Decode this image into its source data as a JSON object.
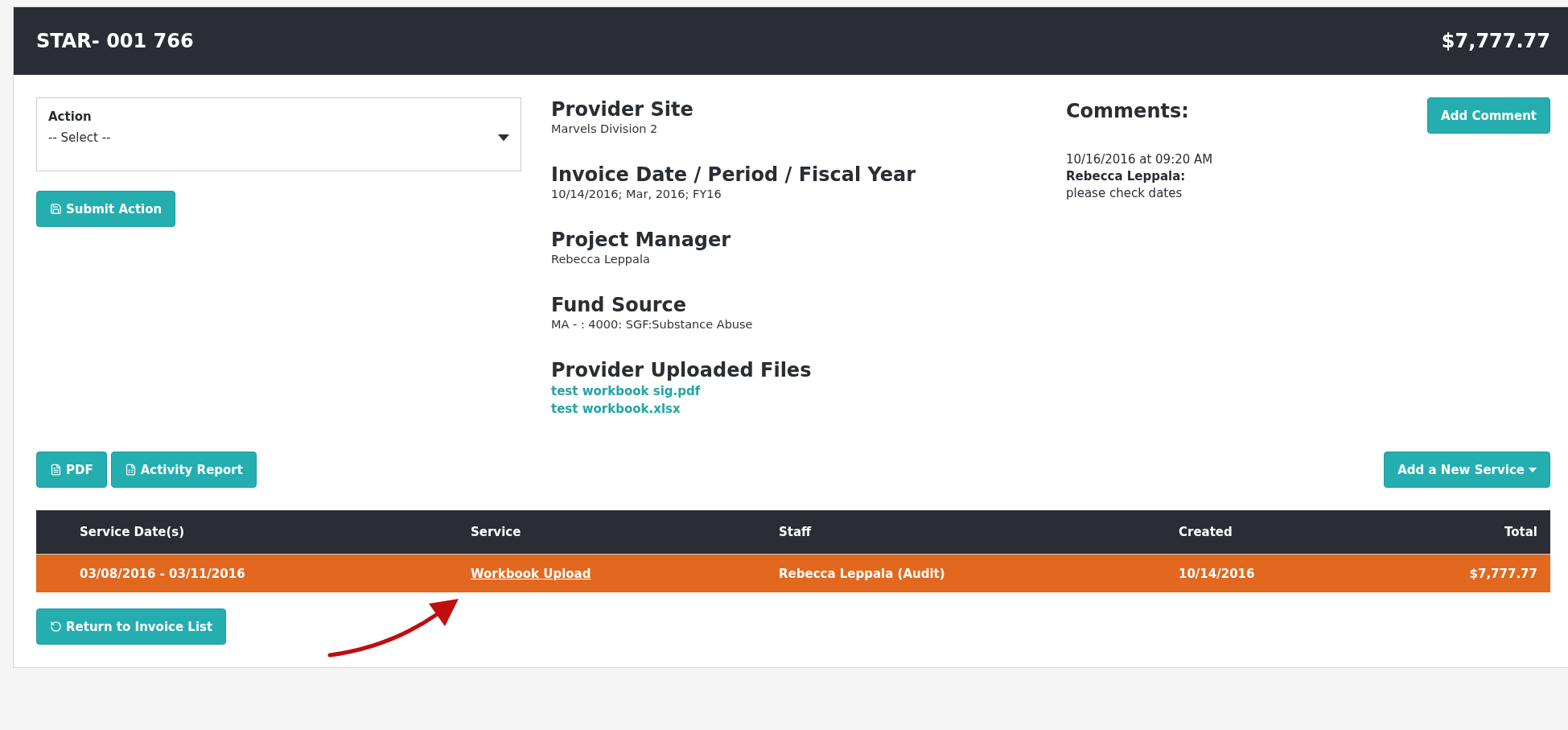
{
  "header": {
    "title": "STAR- 001 766",
    "amount": "$7,777.77"
  },
  "action_field": {
    "label": "Action",
    "value": "-- Select --"
  },
  "submit_button": {
    "label": "Submit Action"
  },
  "details": [
    {
      "heading": "Provider Site",
      "value": "Marvels Division 2"
    },
    {
      "heading": "Invoice Date / Period / Fiscal Year",
      "value": "10/14/2016; Mar, 2016; FY16"
    },
    {
      "heading": "Project Manager",
      "value": "Rebecca Leppala"
    },
    {
      "heading": "Fund Source",
      "value": "MA - : 4000: SGF:Substance Abuse"
    }
  ],
  "uploaded_files": {
    "heading": "Provider Uploaded Files",
    "files": [
      "test workbook sig.pdf",
      "test workbook.xlsx"
    ]
  },
  "comments": {
    "heading": "Comments:",
    "add_button": "Add Comment",
    "items": [
      {
        "time": "10/16/2016 at 09:20 AM",
        "author": "Rebecca Leppala:",
        "text": "please check dates"
      }
    ]
  },
  "pdf_button": {
    "label": "PDF"
  },
  "activity_report_button": {
    "label": "Activity Report"
  },
  "add_service_button": {
    "label": "Add a New Service"
  },
  "table": {
    "columns": [
      "Service Date(s)",
      "Service",
      "Staff",
      "Created",
      "Total"
    ],
    "rows": [
      {
        "cells": [
          {
            "kind": "text",
            "text": "03/08/2016 - 03/11/2016"
          },
          {
            "kind": "link",
            "text": "Workbook Upload"
          },
          {
            "kind": "text",
            "text": "Rebecca Leppala (Audit)"
          },
          {
            "kind": "text",
            "text": "10/14/2016"
          },
          {
            "kind": "text",
            "text": "$7,777.77"
          }
        ]
      }
    ]
  },
  "return_button": {
    "label": "Return to Invoice List"
  }
}
